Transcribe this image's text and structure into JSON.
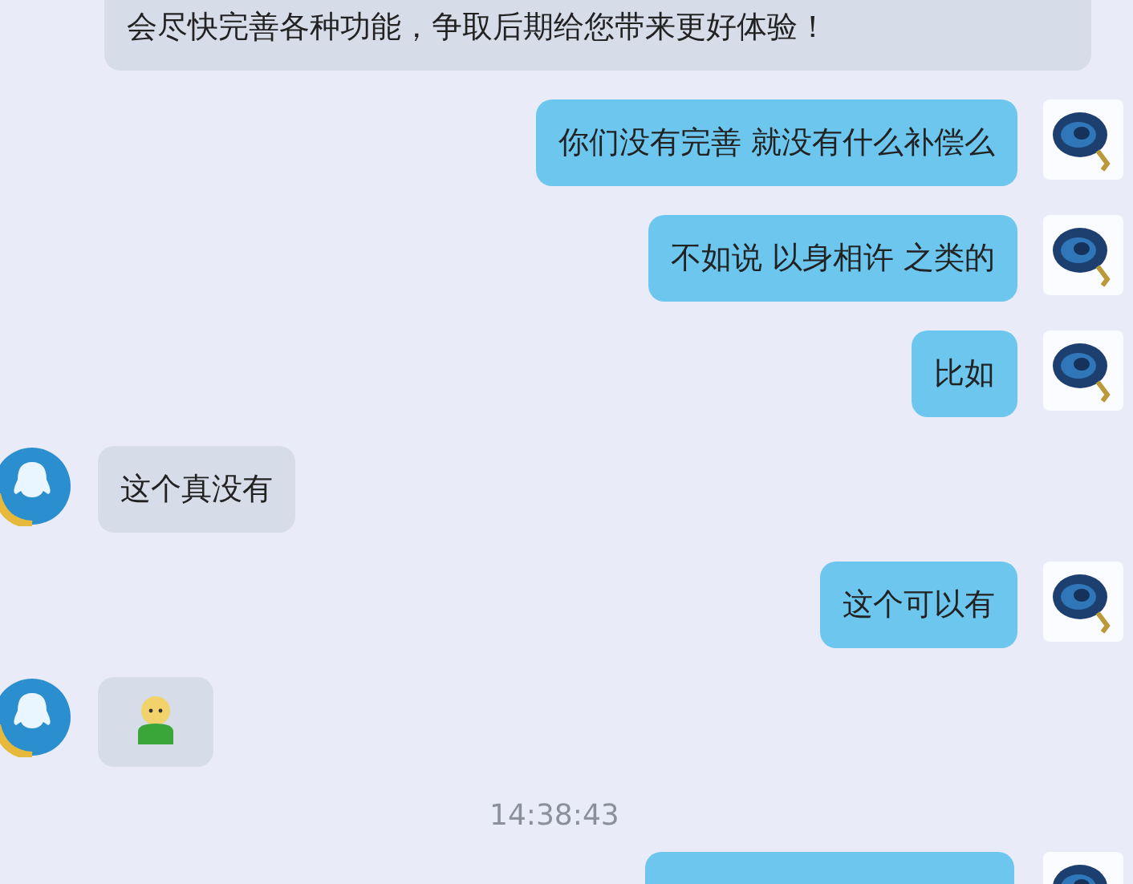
{
  "messages": [
    {
      "outgoing": false,
      "kind": "cut",
      "text": "会尽快完善各种功能，争取后期给您带来更好体验！"
    },
    {
      "outgoing": true,
      "kind": "text",
      "text": "你们没有完善 就没有什么补偿么"
    },
    {
      "outgoing": true,
      "kind": "text",
      "text": "不如说 以身相许 之类的"
    },
    {
      "outgoing": true,
      "kind": "text",
      "text": "比如"
    },
    {
      "outgoing": false,
      "kind": "text",
      "text": "这个真没有"
    },
    {
      "outgoing": true,
      "kind": "text",
      "text": "这个可以有"
    },
    {
      "outgoing": false,
      "kind": "emoji"
    },
    {
      "kind": "time",
      "text": "14:38:43"
    },
    {
      "outgoing": true,
      "kind": "partial"
    }
  ]
}
